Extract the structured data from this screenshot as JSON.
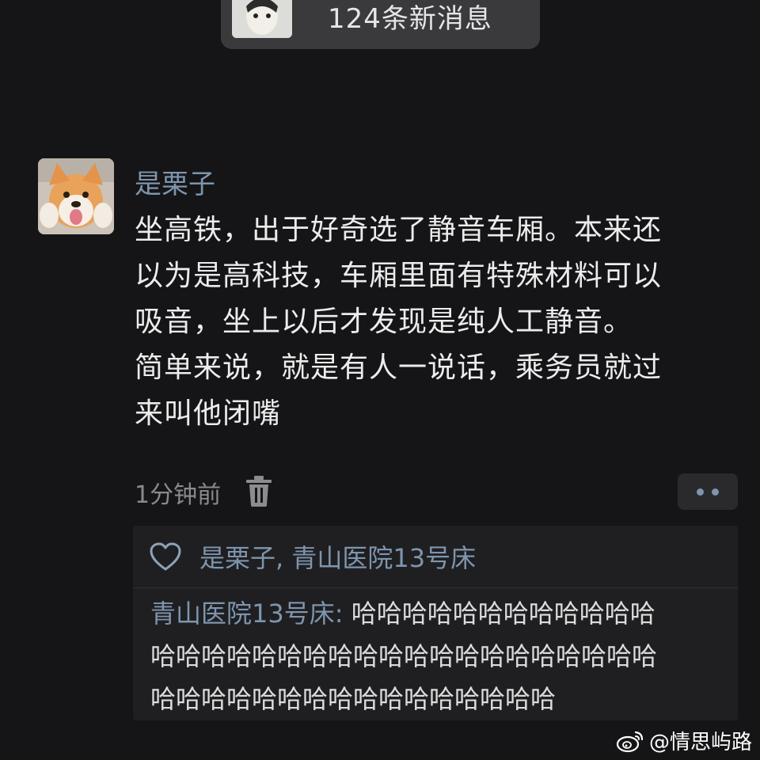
{
  "notification": {
    "text": "124条新消息"
  },
  "post": {
    "username": "是栗子",
    "lines": [
      "坐高铁，出于好奇选了静音车厢。本来还",
      "以为是高科技，车厢里面有特殊材料可以",
      "吸音，坐上以后才发现是纯人工静音。",
      "简单来说，就是有人一说话，乘务员就过",
      "来叫他闭嘴"
    ],
    "timestamp": "1分钟前"
  },
  "likes": {
    "text": "是栗子, 青山医院13号床"
  },
  "comment": {
    "author": "青山医院13号床:",
    "line1_text": "哈哈哈哈哈哈哈哈哈哈哈哈",
    "line2_text": "哈哈哈哈哈哈哈哈哈哈哈哈哈哈哈哈哈哈哈哈",
    "line3_text": "哈哈哈哈哈哈哈哈哈哈哈哈哈哈哈哈"
  },
  "watermark": {
    "text": "@情思屿路"
  },
  "icons": {
    "trash": "trash-icon",
    "heart": "heart-outline-icon",
    "more": "more-dots-icon",
    "weibo": "weibo-logo-icon"
  },
  "colors": {
    "background": "#151517",
    "link_blue": "#7e95ad",
    "panel": "#1f1f22",
    "pill": "#3a3a3d"
  }
}
